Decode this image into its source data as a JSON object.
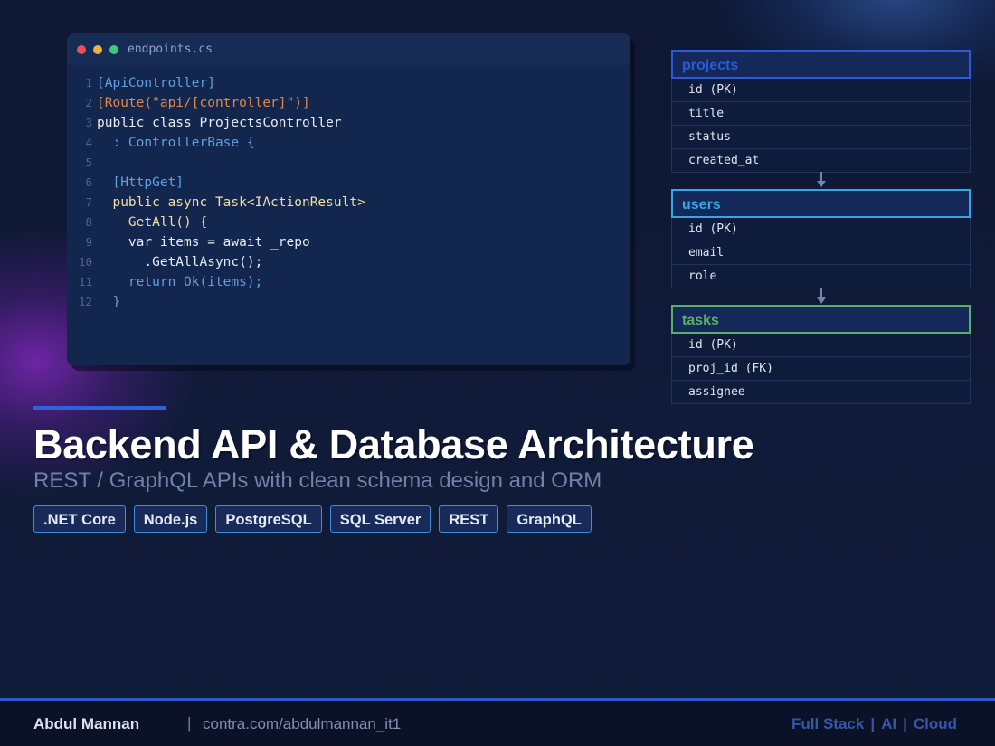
{
  "code_window": {
    "file_name": "endpoints.cs",
    "lines": [
      {
        "n": "1",
        "segs": [
          {
            "t": "[ApiController]",
            "c": "blue"
          }
        ]
      },
      {
        "n": "2",
        "segs": [
          {
            "t": "[Route(\"api/[controller]\")]",
            "c": "orange"
          }
        ]
      },
      {
        "n": "3",
        "segs": [
          {
            "t": "public class ProjectsController",
            "c": "white"
          }
        ]
      },
      {
        "n": "4",
        "segs": [
          {
            "t": "  : ControllerBase {",
            "c": "blue"
          }
        ]
      },
      {
        "n": "5",
        "segs": [
          {
            "t": "",
            "c": "white"
          }
        ]
      },
      {
        "n": "6",
        "segs": [
          {
            "t": "  [HttpGet]",
            "c": "blue"
          }
        ]
      },
      {
        "n": "7",
        "segs": [
          {
            "t": "  public async Task<IActionResult>",
            "c": "cream"
          }
        ]
      },
      {
        "n": "8",
        "segs": [
          {
            "t": "    GetAll() {",
            "c": "cream"
          }
        ]
      },
      {
        "n": "9",
        "segs": [
          {
            "t": "    var items = await _repo",
            "c": "white"
          }
        ]
      },
      {
        "n": "10",
        "segs": [
          {
            "t": "      .GetAllAsync();",
            "c": "white"
          }
        ]
      },
      {
        "n": "11",
        "segs": [
          {
            "t": "    return Ok(items);",
            "c": "blue"
          }
        ]
      },
      {
        "n": "12",
        "segs": [
          {
            "t": "  }",
            "c": "blue"
          }
        ]
      }
    ]
  },
  "schema": [
    {
      "name": "projects",
      "color": "#2a5ad6",
      "fields": [
        "id (PK)",
        "title",
        "status",
        "created_at"
      ]
    },
    {
      "name": "users",
      "color": "#35a6e6",
      "fields": [
        "id (PK)",
        "email",
        "role"
      ]
    },
    {
      "name": "tasks",
      "color": "#5aae6a",
      "fields": [
        "id (PK)",
        "proj_id (FK)",
        "assignee"
      ]
    }
  ],
  "hero": {
    "title": "Backend API & Database Architecture",
    "subtitle": "REST / GraphQL APIs with clean schema design and ORM",
    "tags": [
      ".NET Core",
      "Node.js",
      "PostgreSQL",
      "SQL Server",
      "REST",
      "GraphQL"
    ]
  },
  "footer": {
    "author": "Abdul Mannan",
    "separator": "|",
    "link": "contra.com/abdulmannan_it1",
    "right": [
      "Full Stack",
      "AI",
      "Cloud"
    ],
    "right_sep": "|"
  }
}
